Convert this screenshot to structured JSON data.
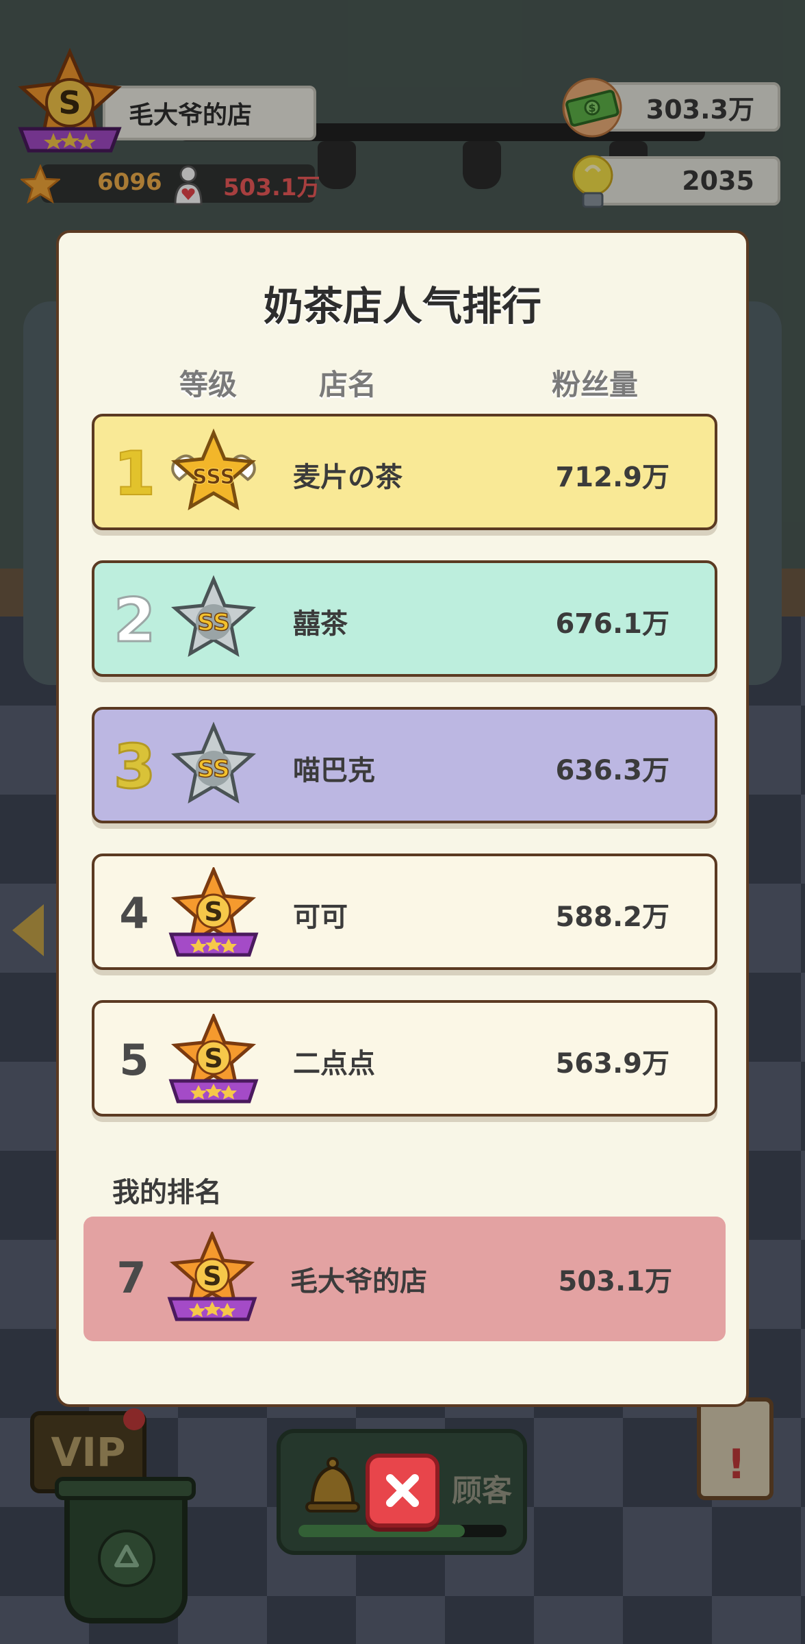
{
  "hud": {
    "shop_name": "毛大爷的店",
    "stars": "6096",
    "fans": "503.1万",
    "cash": "303.3万",
    "ideas": "2035",
    "level_badge": "S"
  },
  "modal": {
    "title": "奶茶店人气排行",
    "columns": {
      "level": "等级",
      "name": "店名",
      "fans": "粉丝量"
    },
    "rows": [
      {
        "rank": "1",
        "badge": "SSS",
        "name": "麦片の茶",
        "fans": "712.9万"
      },
      {
        "rank": "2",
        "badge": "SS",
        "name": "囍茶",
        "fans": "676.1万"
      },
      {
        "rank": "3",
        "badge": "SS",
        "name": "喵巴克",
        "fans": "636.3万"
      },
      {
        "rank": "4",
        "badge": "S",
        "name": "可可",
        "fans": "588.2万"
      },
      {
        "rank": "5",
        "badge": "S",
        "name": "二点点",
        "fans": "563.9万"
      }
    ],
    "my_rank_label": "我的排名",
    "my_rank": {
      "rank": "7",
      "badge": "S",
      "name": "毛大爷的店",
      "fans": "503.1万"
    }
  },
  "background": {
    "vip_label": "VIP",
    "bell_label": "顾客",
    "bell_progress": 0.8
  },
  "colors": {
    "row1": "#f9e996",
    "row2": "#bdeedd",
    "row3": "#bcb7e2",
    "row_plain": "#fbf7e6",
    "my_row": "#e3a2a2",
    "close": "#e8454b"
  },
  "icons": {
    "badge_sss": "winged-gold-star-badge",
    "badge_ss": "silver-star-badge",
    "badge_s": "bronze-star-ribbon-badge",
    "close": "close-x-icon"
  }
}
